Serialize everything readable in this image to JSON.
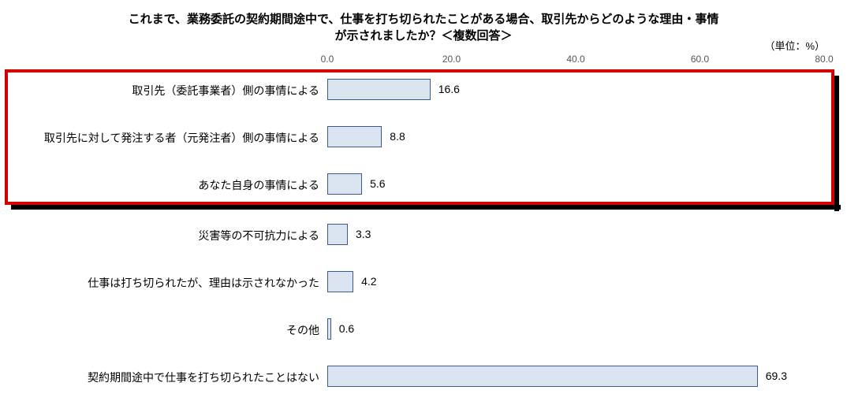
{
  "title_line1": "これまで、業務委託の契約期間途中で、仕事を打ち切られたことがある場合、取引先からどのような理由・事情",
  "title_line2": "が示されましたか？＜複数回答＞",
  "unit_label": "（単位：%）",
  "chart_data": {
    "type": "bar",
    "orientation": "horizontal",
    "xlabel": "",
    "ylabel": "",
    "xlim": [
      0,
      80
    ],
    "ticks": [
      0.0,
      20.0,
      40.0,
      60.0,
      80.0
    ],
    "tick_labels": [
      "0.0",
      "20.0",
      "40.0",
      "60.0",
      "80.0"
    ],
    "categories": [
      "取引先（委託事業者）側の事情による",
      "取引先に対して発注する者（元発注者）側の事情による",
      "あなた自身の事情による",
      "災害等の不可抗力による",
      "仕事は打ち切られたが、理由は示されなかった",
      "その他",
      "契約期間途中で仕事を打ち切られたことはない"
    ],
    "values": [
      16.6,
      8.8,
      5.6,
      3.3,
      4.2,
      0.6,
      69.3
    ],
    "highlighted_rows": [
      0,
      1,
      2
    ]
  }
}
